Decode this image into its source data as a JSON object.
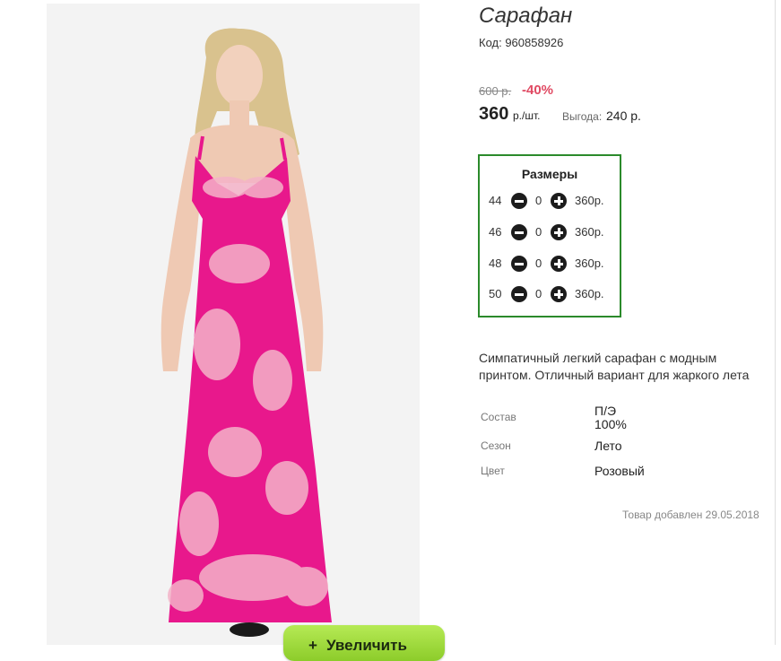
{
  "product": {
    "title": "Сарафан",
    "code": "Код: 960858926",
    "old_price": "600 р.",
    "discount": "-40%",
    "price": "360",
    "price_unit": "р./шт.",
    "benefit_label": "Выгода:",
    "benefit_value": "240 р."
  },
  "sizes": {
    "title": "Размеры",
    "rows": [
      {
        "size": "44",
        "qty": "0",
        "price": "360р."
      },
      {
        "size": "46",
        "qty": "0",
        "price": "360р."
      },
      {
        "size": "48",
        "qty": "0",
        "price": "360р."
      },
      {
        "size": "50",
        "qty": "0",
        "price": "360р."
      }
    ]
  },
  "description": "Симпатичный легкий сарафан с модным принтом. Отличный вариант для жаркого лета",
  "attributes": [
    {
      "label": "Состав",
      "value_line1": "П/Э",
      "value_line2": "100%"
    },
    {
      "label": "Сезон",
      "value": "Лето"
    },
    {
      "label": "Цвет",
      "value": "Розовый"
    }
  ],
  "added_date": "Товар добавлен 29.05.2018",
  "zoom_button": {
    "icon": "+",
    "label": "Увеличить"
  },
  "colors": {
    "dress": "#e8188c",
    "discount": "#e04a63",
    "sizes_border": "#2b8a2b",
    "zoom_button": "#9ed63a"
  }
}
